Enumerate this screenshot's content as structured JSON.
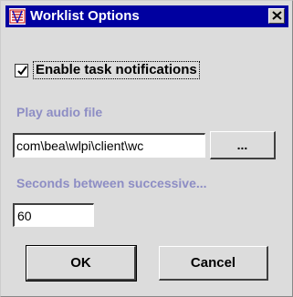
{
  "window": {
    "title": "Worklist Options",
    "title_bar_color": "#0000a0",
    "title_text_color": "#ffffff",
    "icon": "app-icon",
    "close_icon": "close-icon"
  },
  "notifications": {
    "label": "Enable task notifications",
    "checked": true
  },
  "audio": {
    "label": "Play audio file",
    "path_value": "com\\bea\\wlpi\\client\\wc",
    "browse_label": "..."
  },
  "interval": {
    "label": "Seconds between successive...",
    "value": "60"
  },
  "buttons": {
    "ok_label": "OK",
    "cancel_label": "Cancel"
  },
  "colors": {
    "section_label": "#8d8dc4",
    "dialog_background": "#dcdcdc"
  }
}
